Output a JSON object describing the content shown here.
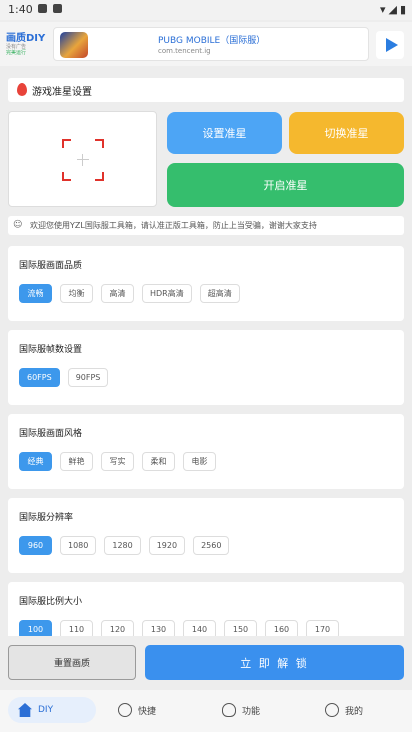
{
  "status_bar": {
    "time": "1:40"
  },
  "ad": {
    "brand_title": "画质DIY",
    "brand_line1": "没有广告",
    "brand_line2": "完美运行",
    "app_title": "PUBG MOBILE（国际服）",
    "app_subtitle": "com.tencent.ig"
  },
  "section_title": "游戏准星设置",
  "buttons": {
    "set_crosshair": "设置准星",
    "switch_crosshair": "切换准星",
    "enable_crosshair": "开启准星"
  },
  "notice": "欢迎您使用YZL国际服工具箱，请认准正版工具箱，防止上当受骗，谢谢大家支持",
  "settings": [
    {
      "title": "国际服画面品质",
      "options": [
        "流畅",
        "均衡",
        "高清",
        "HDR高清",
        "超高清"
      ],
      "selected": 0
    },
    {
      "title": "国际服帧数设置",
      "options": [
        "60FPS",
        "90FPS"
      ],
      "selected": 0
    },
    {
      "title": "国际服画面风格",
      "options": [
        "经典",
        "鲜艳",
        "写实",
        "柔和",
        "电影"
      ],
      "selected": 0
    },
    {
      "title": "国际服分辨率",
      "options": [
        "960",
        "1080",
        "1280",
        "1920",
        "2560"
      ],
      "selected": 0
    },
    {
      "title": "国际服比例大小",
      "options": [
        "100",
        "110",
        "120",
        "130",
        "140",
        "150",
        "160",
        "170"
      ],
      "selected": 0
    }
  ],
  "actions": {
    "reset": "重置画质",
    "unlock": "立 即 解 锁"
  },
  "tabs": [
    {
      "label": "DIY",
      "icon": "home-icon",
      "active": true
    },
    {
      "label": "快捷",
      "icon": "compass-icon",
      "active": false
    },
    {
      "label": "功能",
      "icon": "lightbulb-icon",
      "active": false
    },
    {
      "label": "我的",
      "icon": "smile-icon",
      "active": false
    }
  ],
  "colors": {
    "accent_blue": "#3d98ec",
    "set_button": "#4da5f5",
    "switch_button": "#f5b82e",
    "enable_button": "#35be6d",
    "reticle_red": "#e0322b"
  }
}
